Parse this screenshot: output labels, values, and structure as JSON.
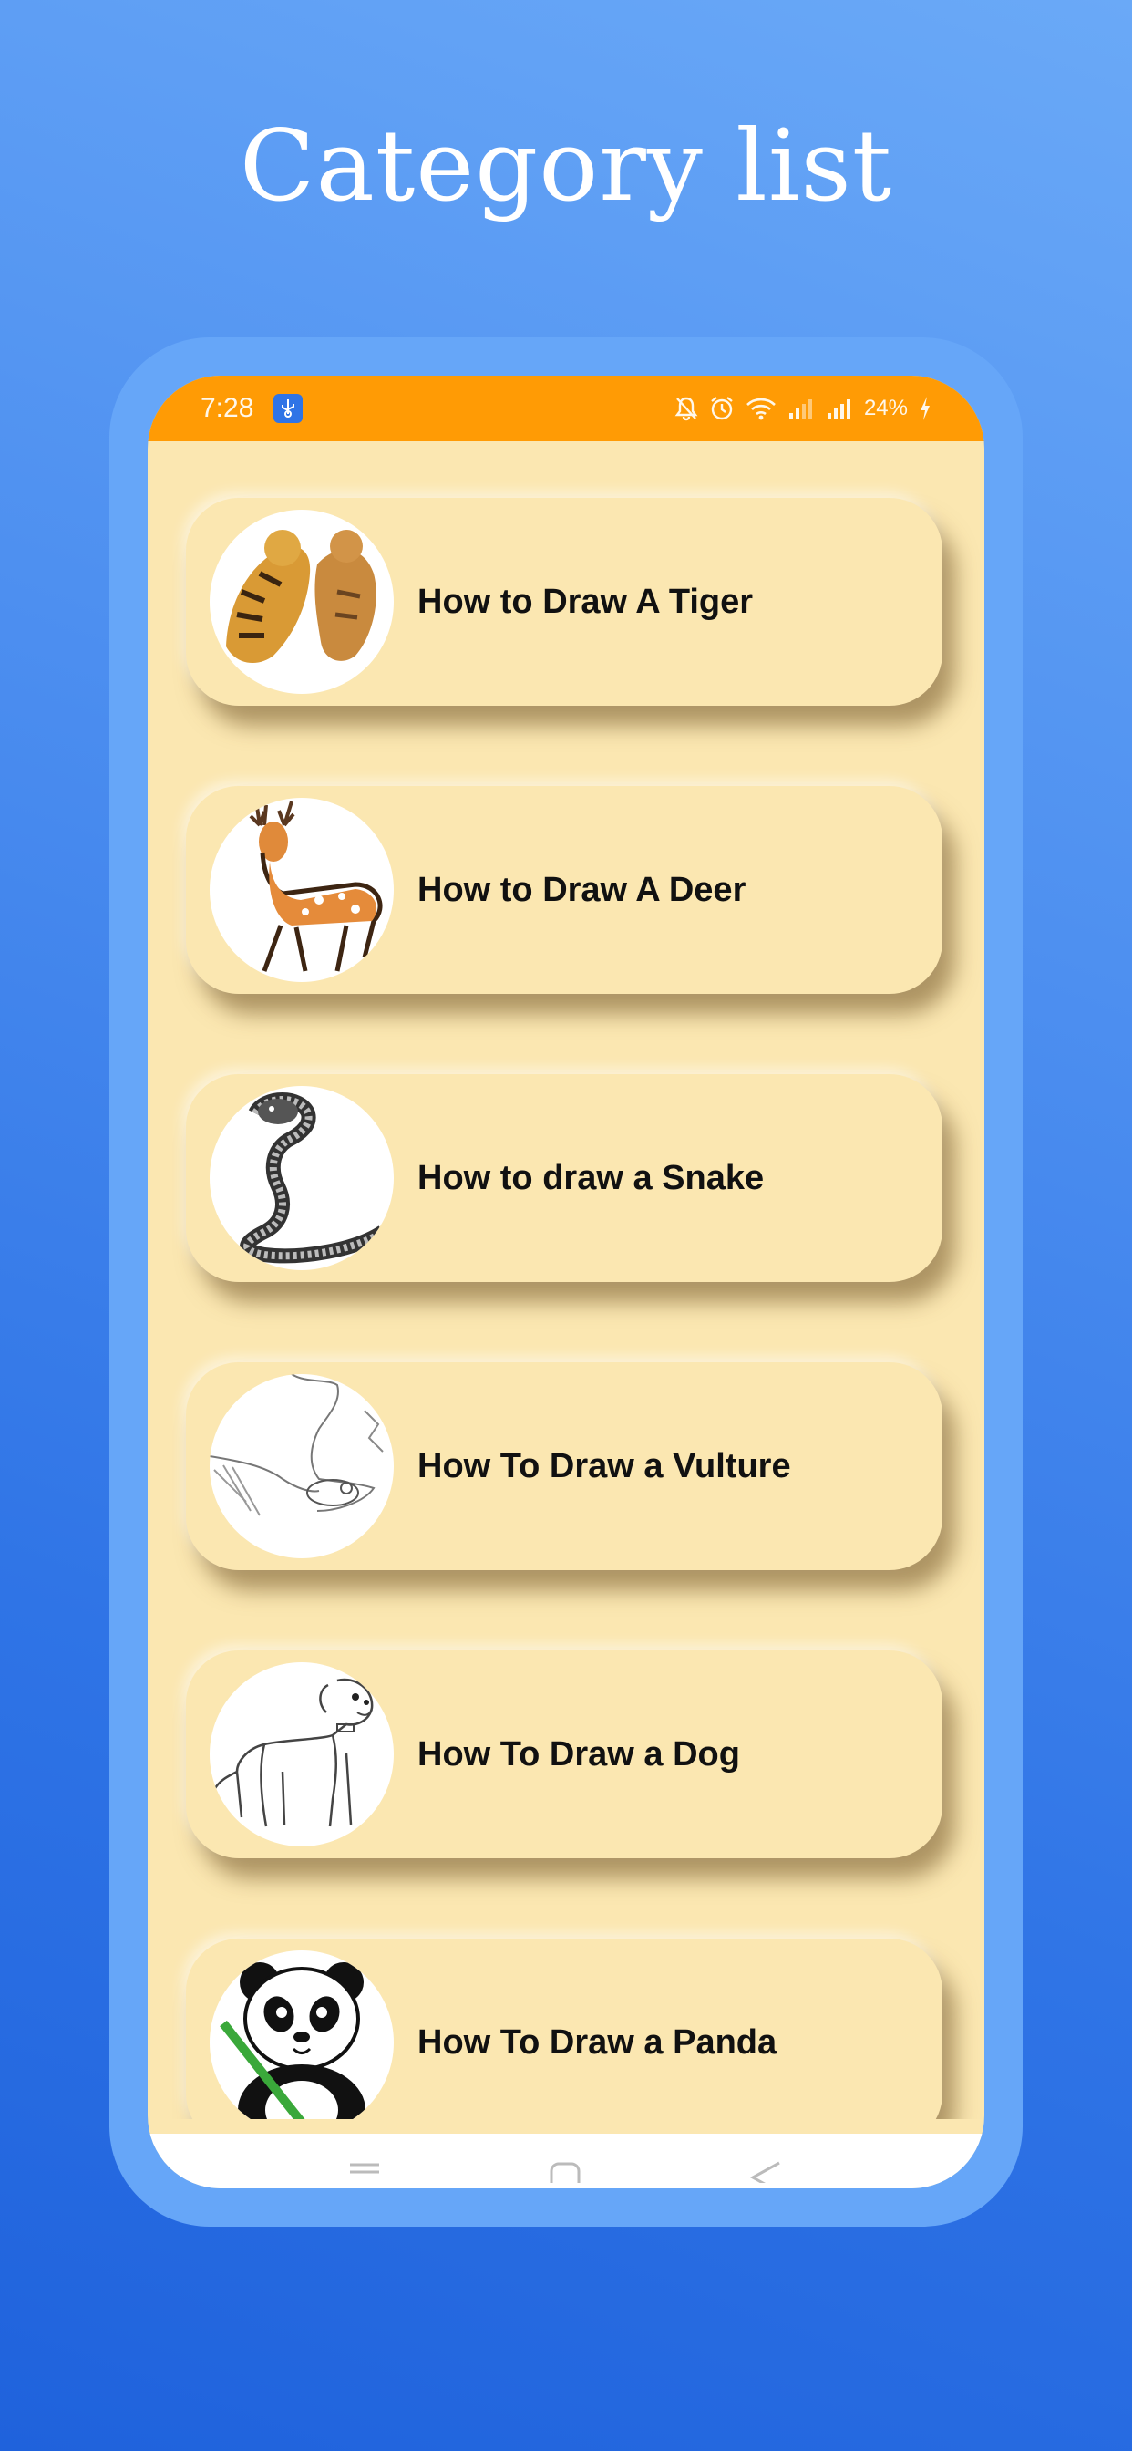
{
  "headline": "Category list",
  "status_bar": {
    "time": "7:28",
    "battery": "24%",
    "icons": [
      "usb-debug-icon",
      "mute-icon",
      "alarm-icon",
      "wifi-icon",
      "signal-icon",
      "signal-icon",
      "charging-icon"
    ]
  },
  "categories": [
    {
      "title": "How to Draw A Tiger",
      "icon": "tiger-icon"
    },
    {
      "title": "How to Draw A Deer",
      "icon": "deer-icon"
    },
    {
      "title": "How to draw a Snake",
      "icon": "snake-icon"
    },
    {
      "title": "How To Draw a Vulture",
      "icon": "vulture-icon"
    },
    {
      "title": "How To Draw a Dog",
      "icon": "dog-icon"
    },
    {
      "title": "How To Draw a Panda",
      "icon": "panda-icon"
    }
  ],
  "nav_bar": {
    "icons": [
      "menu-icon",
      "home-icon",
      "back-icon"
    ]
  },
  "colors": {
    "accent": "#ff9b05",
    "card": "#fbe7b1",
    "background": "#2f74e6",
    "frame": "#66a6f8"
  }
}
